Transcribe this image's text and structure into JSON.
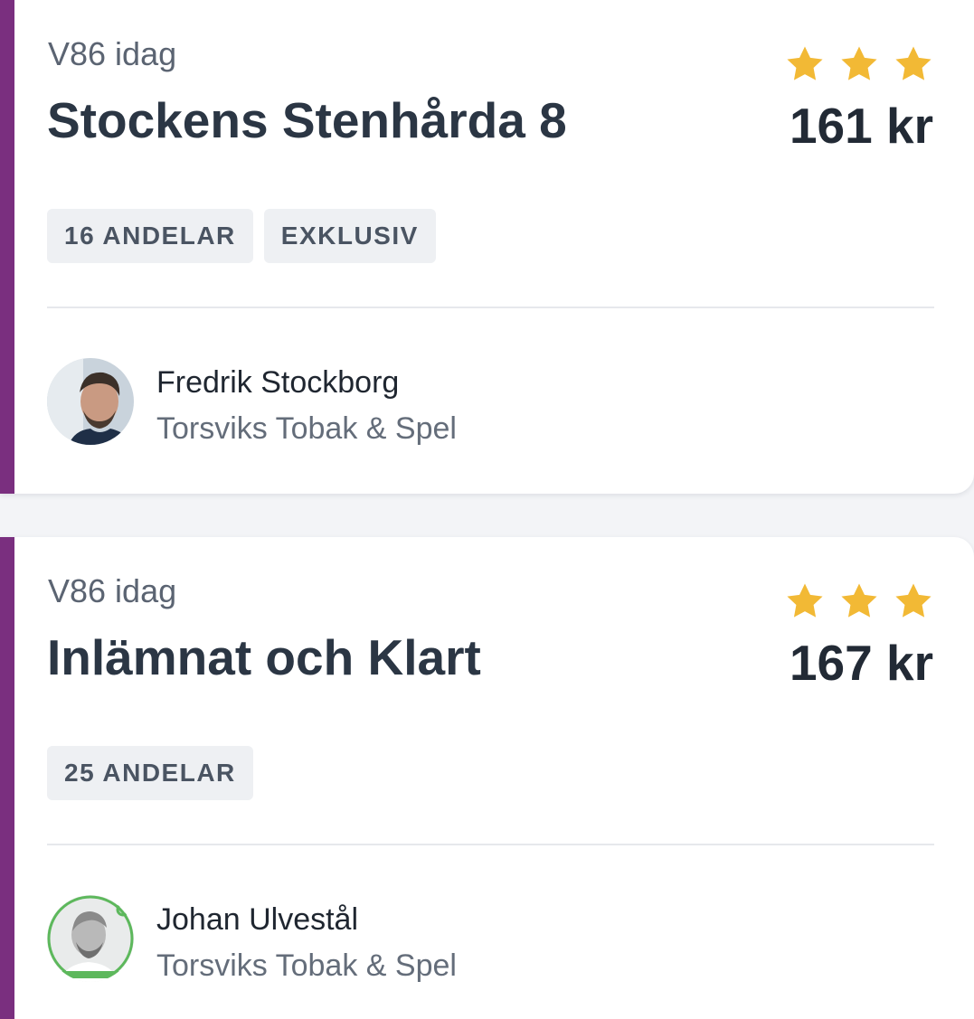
{
  "colors": {
    "accent": "#7a2f7f",
    "star": "#f2b935",
    "background": "#f3f4f7",
    "card": "#ffffff",
    "tag_bg": "#eef0f3"
  },
  "cards": [
    {
      "game": "V86 idag",
      "title": "Stockens Stenhårda 8",
      "stars": 3,
      "price": "161 kr",
      "tags": [
        "16 ANDELAR",
        "EXKLUSIV"
      ],
      "agent": {
        "name": "Fredrik Stockborg",
        "shop": "Torsviks Tobak & Spel",
        "avatar_icon": "avatar-photo"
      }
    },
    {
      "game": "V86 idag",
      "title": "Inlämnat och Klart",
      "stars": 3,
      "price": "167 kr",
      "tags": [
        "25 ANDELAR"
      ],
      "agent": {
        "name": "Johan Ulvestål",
        "shop": "Torsviks Tobak & Spel",
        "avatar_icon": "avatar-photo"
      }
    }
  ]
}
